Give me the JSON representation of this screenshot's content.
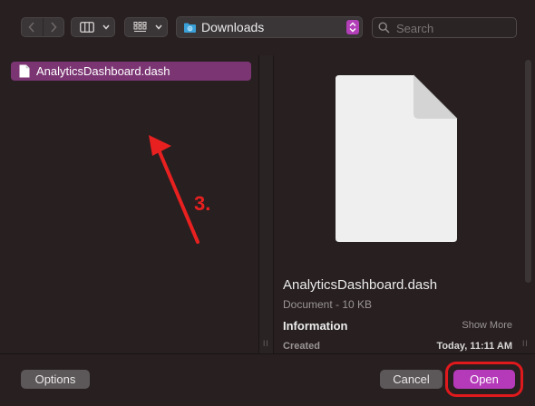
{
  "toolbar": {
    "back_icon": "chevron-left-icon",
    "forward_icon": "chevron-right-icon",
    "view_mode_icon": "columns-icon",
    "group_icon": "grid-icon",
    "location_label": "Downloads",
    "location_icon": "folder-icon",
    "search_placeholder": "Search"
  },
  "file_list": {
    "items": [
      {
        "name": "AnalyticsDashboard.dash",
        "icon": "document-icon",
        "selected": true
      }
    ]
  },
  "preview": {
    "name": "AnalyticsDashboard.dash",
    "kind": "Document - 10 KB",
    "info_title": "Information",
    "show_more": "Show More",
    "created_label": "Created",
    "created_value": "Today, 11:11 AM"
  },
  "footer": {
    "options_label": "Options",
    "cancel_label": "Cancel",
    "open_label": "Open"
  },
  "annotation": {
    "step_label": "3.",
    "color": "#e82020"
  },
  "colors": {
    "background": "#271f20",
    "selection": "#7b3573",
    "accent": "#b53ab9"
  }
}
